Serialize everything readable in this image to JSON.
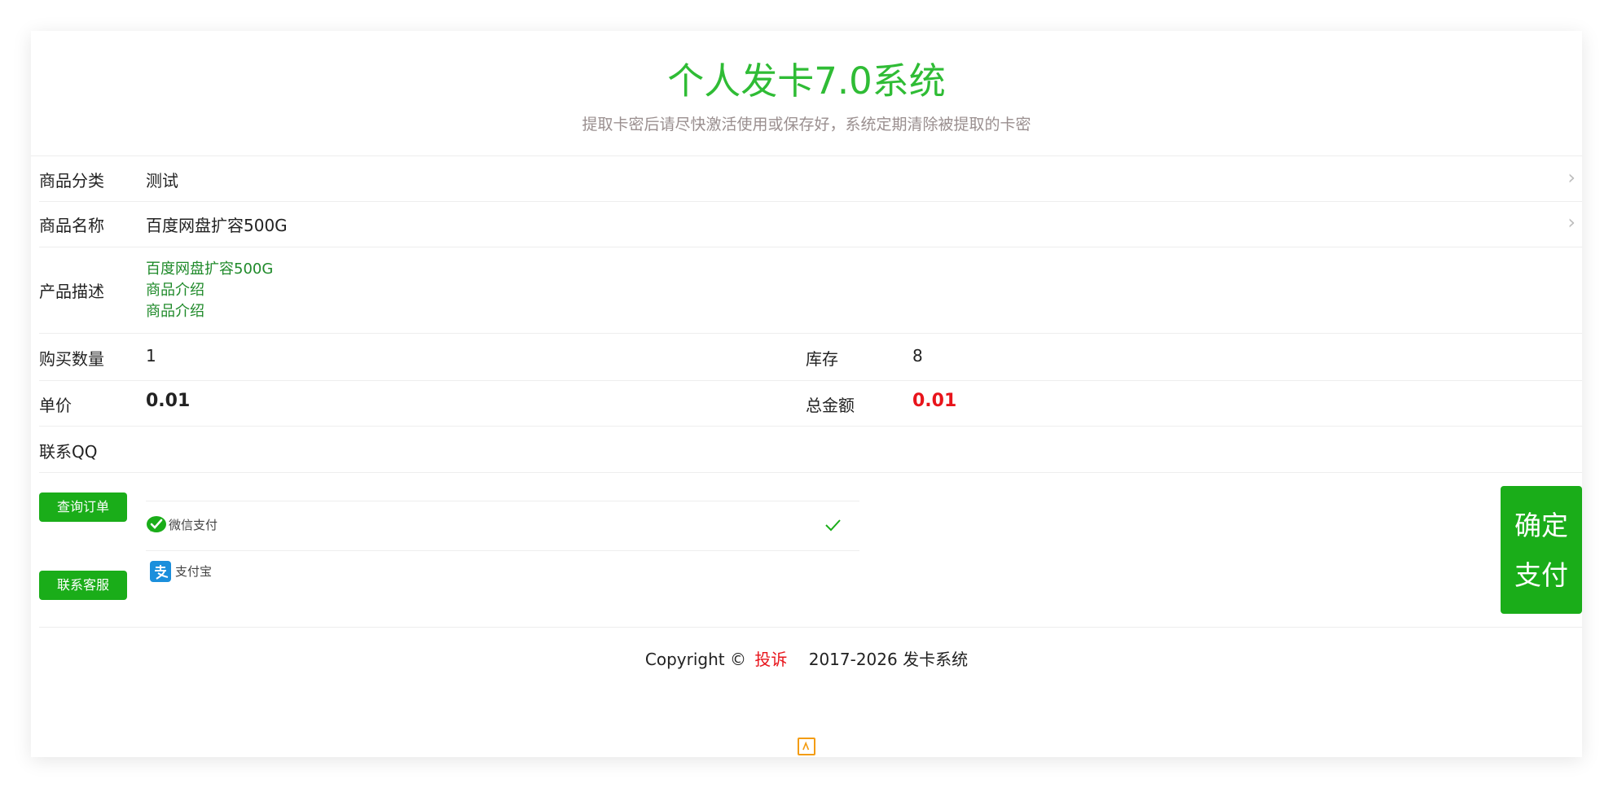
{
  "header": {
    "title": "个人发卡7.0系统",
    "subtitle": "提取卡密后请尽快激活使用或保存好，系统定期清除被提取的卡密"
  },
  "form": {
    "category_label": "商品分类",
    "category_value": "测试",
    "product_label": "商品名称",
    "product_value": "百度网盘扩容500G",
    "description_label": "产品描述",
    "description_lines": [
      "百度网盘扩容500G",
      "商品介绍",
      "商品介绍"
    ],
    "quantity_label": "购买数量",
    "quantity_value": "1",
    "stock_label": "库存",
    "stock_value": "8",
    "price_label": "单价",
    "price_value": "0.01",
    "total_label": "总金额",
    "total_value": "0.01",
    "qq_label": "联系QQ"
  },
  "actions": {
    "query_order": "查询订单",
    "contact_service": "联系客服",
    "confirm_pay": "确定支付"
  },
  "payment_methods": [
    {
      "label": "微信支付",
      "icon": "wechat-pay-icon",
      "selected": true
    },
    {
      "label": "支付宝",
      "icon": "alipay-icon",
      "selected": false
    }
  ],
  "footer": {
    "copyright_prefix": "Copyright ©",
    "complain": "投诉",
    "copyright_suffix": "2017-2026 发卡系统"
  },
  "colors": {
    "brand_green": "#2fbc35",
    "button_green": "#1aad19",
    "price_red": "#e8141b",
    "description_green": "#1f8a2a"
  }
}
